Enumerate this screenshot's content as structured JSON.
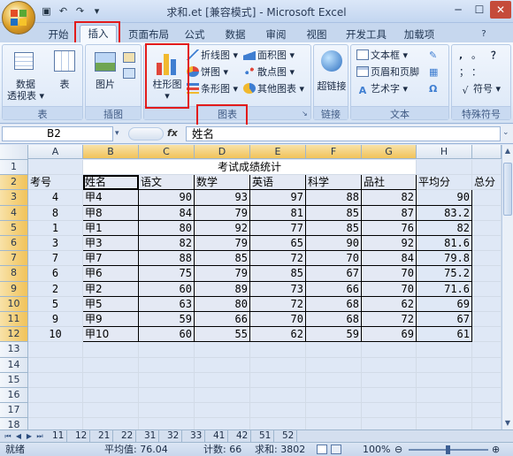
{
  "window": {
    "title": "求和.et  [兼容模式] - Microsoft Excel"
  },
  "quick_access": [
    "save",
    "undo",
    "redo",
    "customize"
  ],
  "tabs": [
    "开始",
    "插入",
    "页面布局",
    "公式",
    "数据",
    "审阅",
    "视图",
    "开发工具",
    "加载项"
  ],
  "ribbon": {
    "table_group": {
      "label": "表",
      "pivot_label": "数据\n透视表",
      "pivot_line1": "数据",
      "pivot_line2": "透视表 ▾",
      "table_label": "表"
    },
    "illustration_group": {
      "label": "插图",
      "picture_label": "图片"
    },
    "chart_group": {
      "label": "图表",
      "column_line1": "柱形图",
      "column_line2": "▾",
      "line": "折线图 ▾",
      "pie": "饼图 ▾",
      "bar": "条形图 ▾",
      "area": "面积图 ▾",
      "scatter": "散点图 ▾",
      "other": "其他图表 ▾"
    },
    "link_group": {
      "label": "链接",
      "hyperlink": "超链接"
    },
    "text_group": {
      "label": "文本",
      "textbox": "文本框 ▾",
      "header_footer": "页眉和页脚",
      "wordart": "艺术字 ▾"
    },
    "symbol_group": {
      "label": "特殊符号",
      "symbol": "符号 ▾",
      "sym1": ",",
      "sym2": "。",
      "sym3": "：",
      "sym4": "；",
      "sym5": "？"
    }
  },
  "formula_bar": {
    "name_box": "B2",
    "fx": "fx",
    "value": "姓名"
  },
  "sheet": {
    "columns": [
      "A",
      "B",
      "C",
      "D",
      "E",
      "F",
      "G",
      "H",
      ""
    ],
    "rows": [
      "1",
      "2",
      "3",
      "4",
      "5",
      "6",
      "7",
      "8",
      "9",
      "10",
      "11",
      "12",
      "13",
      "14",
      "15",
      "16",
      "17",
      "18"
    ],
    "title": "考试成绩统计",
    "headers": [
      "考号",
      "姓名",
      "语文",
      "数学",
      "英语",
      "科学",
      "品社",
      "平均分",
      "总分"
    ],
    "data": [
      [
        "4",
        "甲4",
        "90",
        "93",
        "97",
        "88",
        "82",
        "90"
      ],
      [
        "8",
        "甲8",
        "84",
        "79",
        "81",
        "85",
        "87",
        "83.2"
      ],
      [
        "1",
        "甲1",
        "80",
        "92",
        "77",
        "85",
        "76",
        "82"
      ],
      [
        "3",
        "甲3",
        "82",
        "79",
        "65",
        "90",
        "92",
        "81.6"
      ],
      [
        "7",
        "甲7",
        "88",
        "85",
        "72",
        "70",
        "84",
        "79.8"
      ],
      [
        "6",
        "甲6",
        "75",
        "79",
        "85",
        "67",
        "70",
        "75.2"
      ],
      [
        "2",
        "甲2",
        "60",
        "89",
        "73",
        "66",
        "70",
        "71.6"
      ],
      [
        "5",
        "甲5",
        "63",
        "80",
        "72",
        "68",
        "62",
        "69"
      ],
      [
        "9",
        "甲9",
        "59",
        "66",
        "70",
        "68",
        "72",
        "67"
      ],
      [
        "10",
        "甲10",
        "60",
        "55",
        "62",
        "59",
        "69",
        "61"
      ]
    ]
  },
  "sheet_tabs": [
    "11",
    "12",
    "21",
    "22",
    "31",
    "32",
    "33",
    "41",
    "42",
    "51",
    "52"
  ],
  "status": {
    "ready": "就绪",
    "average": "平均值: 76.04",
    "count": "计数: 66",
    "sum": "求和: 3802",
    "zoom": "100%"
  },
  "colors": {
    "highlight": "#e21b1b",
    "accent": "#d99c24"
  }
}
